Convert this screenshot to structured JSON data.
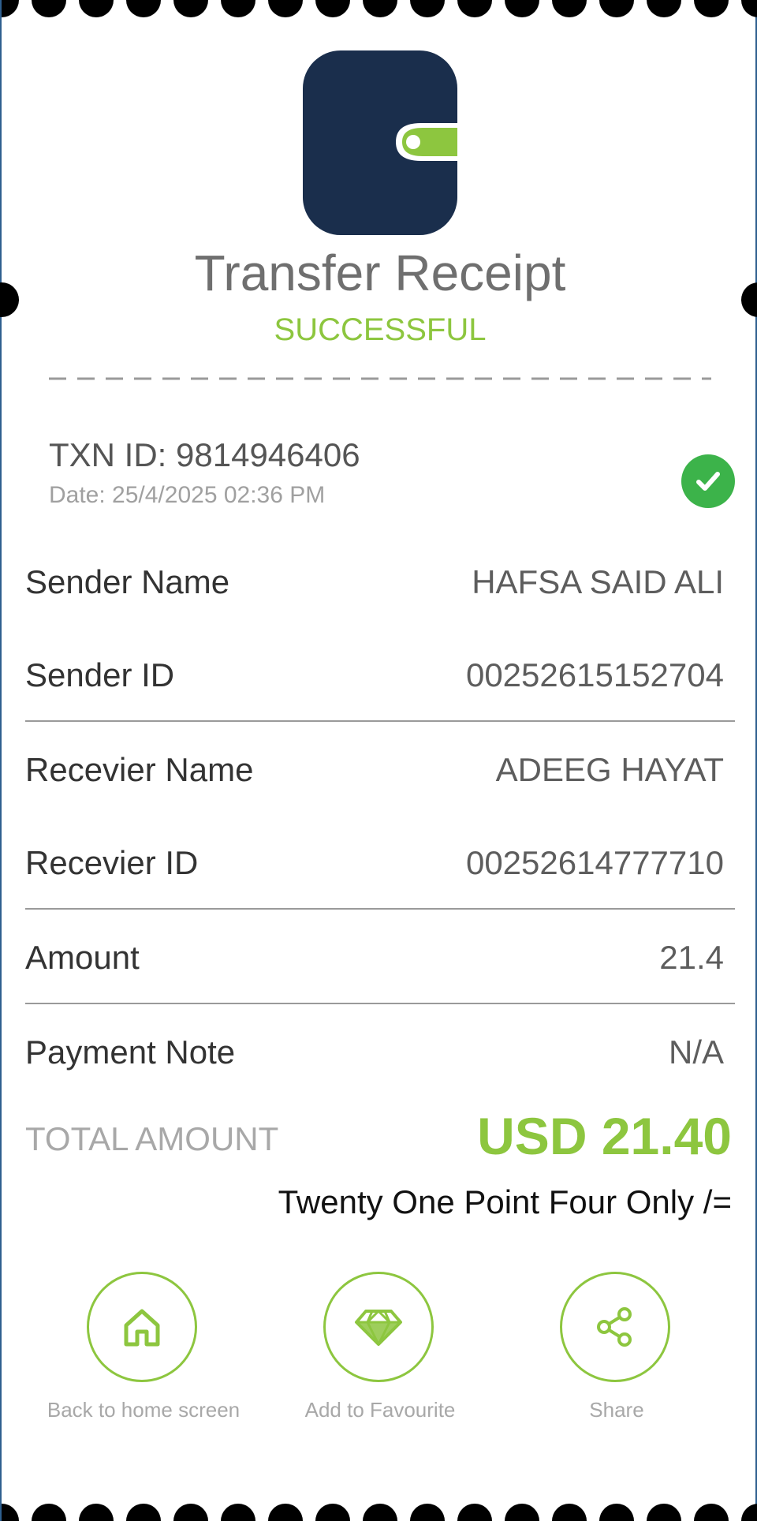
{
  "header": {
    "title": "Transfer Receipt",
    "status": "SUCCESSFUL"
  },
  "transaction": {
    "txn_id": "TXN ID: 9814946406",
    "date": "Date: 25/4/2025 02:36 PM"
  },
  "details": {
    "sender_name_label": "Sender Name",
    "sender_name_value": "HAFSA SAID ALI",
    "sender_id_label": "Sender ID",
    "sender_id_value": "00252615152704",
    "receiver_name_label": "Recevier Name",
    "receiver_name_value": "ADEEG HAYAT",
    "receiver_id_label": "Recevier ID",
    "receiver_id_value": "00252614777710",
    "amount_label": "Amount",
    "amount_value": "21.4",
    "note_label": "Payment Note",
    "note_value": "N/A"
  },
  "total": {
    "label": "TOTAL AMOUNT",
    "value": "USD 21.40",
    "in_words": "Twenty One Point Four Only /="
  },
  "actions": [
    {
      "label": "Back to home screen",
      "icon": "home-icon"
    },
    {
      "label": "Add to Favourite",
      "icon": "diamond-icon"
    },
    {
      "label": "Share",
      "icon": "share-icon"
    }
  ],
  "colors": {
    "accent_green": "#8dc63f",
    "logo_navy": "#1a2e4c",
    "success_green": "#3cb34a"
  }
}
